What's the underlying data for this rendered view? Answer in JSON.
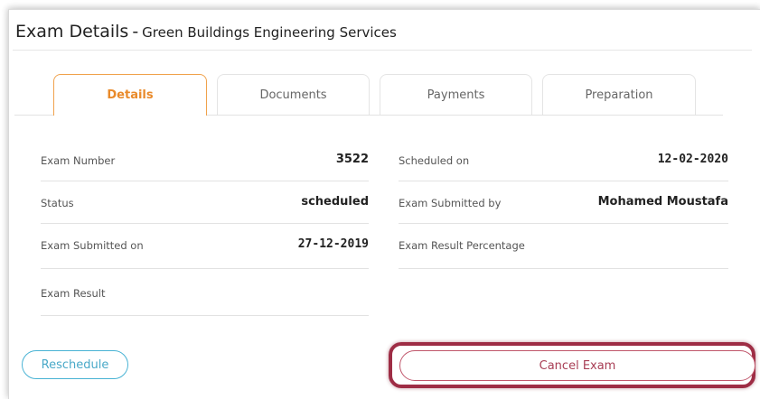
{
  "header": {
    "title": "Exam Details",
    "separator": "-",
    "subtitle": "Green Buildings Engineering Services"
  },
  "tabs": [
    {
      "label": "Details",
      "active": true
    },
    {
      "label": "Documents",
      "active": false
    },
    {
      "label": "Payments",
      "active": false
    },
    {
      "label": "Preparation",
      "active": false
    }
  ],
  "details": {
    "left": [
      {
        "label": "Exam Number",
        "value": "3522"
      },
      {
        "label": "Status",
        "value": "scheduled"
      },
      {
        "label": "Exam Submitted on",
        "value": "27-12-2019"
      },
      {
        "label": "Exam Result",
        "value": ""
      }
    ],
    "right": [
      {
        "label": "Scheduled on",
        "value": "12-02-2020"
      },
      {
        "label": "Exam Submitted by",
        "value": "Mohamed Moustafa"
      },
      {
        "label": "Exam Result Percentage",
        "value": ""
      }
    ]
  },
  "actions": {
    "reschedule_label": "Reschedule",
    "cancel_label": "Cancel Exam"
  },
  "colors": {
    "active_tab": "#e98a2a",
    "reschedule": "#49a9c8",
    "cancel": "#a83e55",
    "highlight": "#9e2d45"
  }
}
